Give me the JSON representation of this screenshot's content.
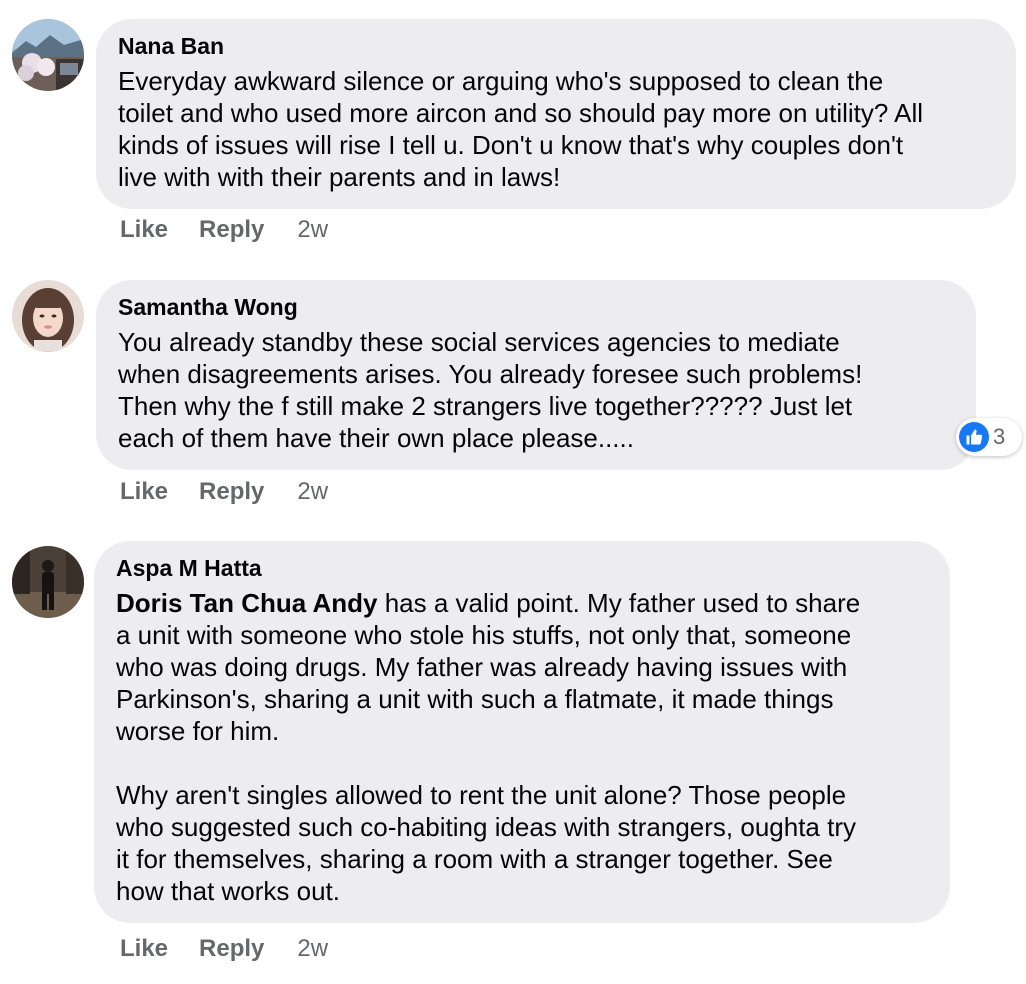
{
  "actions": {
    "like": "Like",
    "reply": "Reply"
  },
  "colors": {
    "bubble": "#ededf0",
    "meta": "#65676b",
    "like_blue": "#1877f2"
  },
  "comments": [
    {
      "author": "Nana Ban",
      "avatar_icon": "landscape-avatar-icon",
      "text": "Everyday awkward silence or arguing who's supposed to clean the\ntoilet and who used more aircon and so should pay more on utility? All\nkinds of issues will rise I tell u. Don't u know that's why couples don't\nlive with with their parents and in laws!",
      "time": "2w"
    },
    {
      "author": "Samantha Wong",
      "avatar_icon": "person-avatar-icon",
      "text": "You already standby these social services agencies to mediate\nwhen disagreements arises. You already foresee such problems!\nThen why the f still make 2 strangers live together????? Just let\neach of them have their own place please.....",
      "time": "2w",
      "reactions": {
        "icon": "thumbs-up-icon",
        "count": "3"
      }
    },
    {
      "author": "Aspa M Hatta",
      "avatar_icon": "figure-avatar-icon",
      "mention": "Doris Tan Chua Andy",
      "text": " has a valid point. My father used to share\na unit with someone who stole his stuffs, not only that, someone\nwho was doing drugs. My father was already having issues with\nParkinson's, sharing a unit with such a flatmate, it made things\nworse for him.\n\nWhy aren't singles allowed to rent the unit alone? Those people\nwho suggested such co-habiting ideas with strangers, oughta try\nit for themselves, sharing a room with a stranger together. See\nhow that works out.",
      "time": "2w"
    }
  ]
}
